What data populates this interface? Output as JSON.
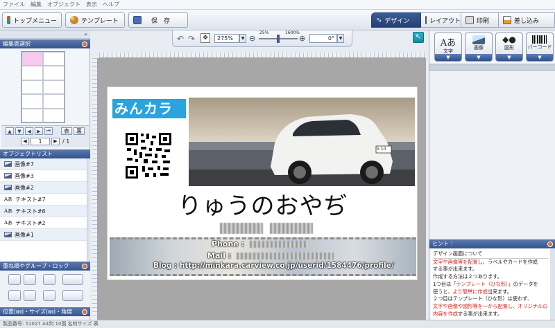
{
  "menubar": [
    "ファイル",
    "編集",
    "オブジェクト",
    "表示",
    "ヘルプ"
  ],
  "toolbar": {
    "top_menu": "トップメニュー",
    "template": "テンプレート",
    "save": "保　存"
  },
  "modes": {
    "design": "デザイン",
    "layout": "レイアウト",
    "print": "印刷",
    "merge": "差し込み"
  },
  "zoom": {
    "value": "275%",
    "min": "25%",
    "max": "1600%",
    "angle": "0°"
  },
  "left_panel": {
    "page_select_title": "編集面選択",
    "page_number": "1",
    "page_total": "/ 1",
    "front": "表",
    "back": "裏",
    "object_list_title": "オブジェクトリスト",
    "objects": [
      {
        "icon": "image-icon",
        "label": "画像#7"
      },
      {
        "icon": "image-icon",
        "label": "画像#3"
      },
      {
        "icon": "image-icon",
        "label": "画像#2"
      },
      {
        "icon": "text-icon",
        "label": "テキスト#7"
      },
      {
        "icon": "text-icon",
        "label": "テキスト#6"
      },
      {
        "icon": "text-icon",
        "label": "テキスト#2"
      },
      {
        "icon": "image-icon",
        "label": "画像#1"
      }
    ],
    "order_group_title": "重ね順やグループ・ロック",
    "position_title": "位置(㎜)・サイズ(㎜)・角度"
  },
  "right_panel": {
    "buttons": {
      "text": "文字",
      "image": "画像",
      "shape": "図形",
      "barcode": "バーコード"
    },
    "hint_title": "ヒント",
    "hint_heading": "デザイン画面について",
    "hint_lines": [
      {
        "parts": [
          [
            "文字や画像等を配置",
            "red"
          ],
          [
            "し、ラベルやカードを作成",
            "black"
          ]
        ]
      },
      {
        "parts": [
          [
            "する事が出来ます。",
            "black"
          ]
        ]
      },
      {
        "parts": [
          [
            "作成する方法は２つあります。",
            "black"
          ]
        ]
      },
      {
        "parts": [
          [
            "1つ目は「",
            "black"
          ],
          [
            "テンプレート（ひな形）",
            "red"
          ],
          [
            "」のデータを",
            "black"
          ]
        ]
      },
      {
        "parts": [
          [
            "使うと、",
            "black"
          ],
          [
            "より簡単に作成",
            "red"
          ],
          [
            "出来ます。",
            "black"
          ]
        ]
      },
      {
        "parts": [
          [
            "２つ目はテンプレート（ひな形）は使わず、",
            "black"
          ]
        ]
      },
      {
        "parts": [
          [
            "文字や画像や図形等を一から配置し、",
            "red"
          ],
          [
            "オリジナルの",
            "red"
          ]
        ]
      },
      {
        "parts": [
          [
            "内容を作成",
            "red"
          ],
          [
            "する事が出来ます。",
            "black"
          ]
        ]
      }
    ]
  },
  "card": {
    "logo": "みんカラ",
    "name": "りゅうのおやぢ",
    "phone_label": "Phone :",
    "mail_label": "Mail :",
    "blog": "Blog : http://minkara.carview.co.jp/userid/1584476/profile/",
    "plate": "5 10"
  },
  "statusbar": "製品番号: 51027 A4判 10面 名刺サイズ 表",
  "colors": {
    "accent": "#34548d",
    "hint_red": "#e0201a",
    "card_bg": "#ffffff",
    "canvas": "#a7a7a7"
  }
}
